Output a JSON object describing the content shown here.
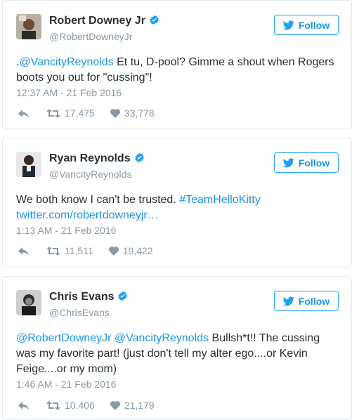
{
  "colors": {
    "link": "#1b95e0",
    "verified": "#1da1f2",
    "meta": "#8899a6",
    "text": "#292f33",
    "border": "#e1e8ed"
  },
  "follow_label": "Follow",
  "tweets": [
    {
      "name": "Robert Downey Jr",
      "handle": "@RobertDowneyJr",
      "text": [
        {
          "t": ".",
          "link": false
        },
        {
          "t": "@VancityReynolds",
          "link": true
        },
        {
          "t": " Et tu, D-pool? Gimme a shout when Rogers boots you out for \"cussing\"!",
          "link": false
        }
      ],
      "time": "12:37 AM - 21 Feb 2016",
      "retweets": "17,475",
      "likes": "33,778"
    },
    {
      "name": "Ryan Reynolds",
      "handle": "@VancityReynolds",
      "text": [
        {
          "t": "We both know I can't be trusted. ",
          "link": false
        },
        {
          "t": "#TeamHelloKitty",
          "link": true
        },
        {
          "t": " twitter.com/robertdowneyjr…",
          "link": true
        }
      ],
      "time": "1:13 AM - 21 Feb 2016",
      "retweets": "11,511",
      "likes": "19,422"
    },
    {
      "name": "Chris Evans",
      "handle": "@ChrisEvans",
      "text": [
        {
          "t": "@RobertDowneyJr",
          "link": true
        },
        {
          "t": " ",
          "link": false
        },
        {
          "t": "@VancityReynolds",
          "link": true
        },
        {
          "t": " Bullsh*t!! The cussing was my favorite part! (just don't tell my alter ego....or Kevin Feige....or my mom)",
          "link": false
        }
      ],
      "time": "1:46 AM - 21 Feb 2016",
      "retweets": "10,406",
      "likes": "21,179"
    }
  ]
}
